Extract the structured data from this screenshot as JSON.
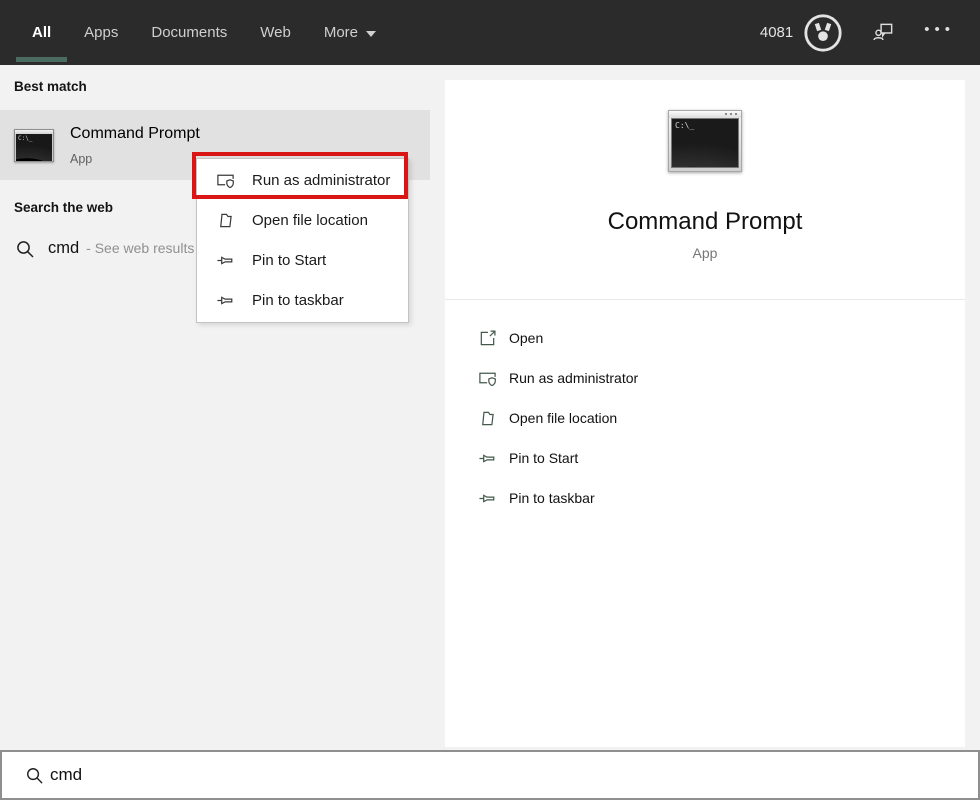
{
  "topbar": {
    "tabs": [
      {
        "label": "All",
        "active": true
      },
      {
        "label": "Apps",
        "active": false
      },
      {
        "label": "Documents",
        "active": false
      },
      {
        "label": "Web",
        "active": false
      },
      {
        "label": "More",
        "active": false,
        "has_dropdown": true
      }
    ],
    "rewards_count": "4081",
    "ellipsis": "•••"
  },
  "left_panel": {
    "best_match_header": "Best match",
    "best_match": {
      "title": "Command Prompt",
      "subtitle": "App"
    },
    "search_web_header": "Search the web",
    "web_item": {
      "query": "cmd",
      "suffix": "- See web results"
    }
  },
  "context_menu": {
    "items": [
      {
        "label": "Run as administrator",
        "icon": "run-as-admin-icon",
        "annotated": true
      },
      {
        "label": "Open file location",
        "icon": "folder-icon",
        "annotated": false
      },
      {
        "label": "Pin to Start",
        "icon": "pin-icon",
        "annotated": false
      },
      {
        "label": "Pin to taskbar",
        "icon": "pin-icon",
        "annotated": false
      }
    ]
  },
  "right_panel": {
    "title": "Command Prompt",
    "subtitle": "App",
    "app_icon_text": "C:\\_",
    "actions": [
      {
        "label": "Open",
        "icon": "open-icon"
      },
      {
        "label": "Run as administrator",
        "icon": "run-as-admin-icon"
      },
      {
        "label": "Open file location",
        "icon": "folder-icon"
      },
      {
        "label": "Pin to Start",
        "icon": "pin-icon"
      },
      {
        "label": "Pin to taskbar",
        "icon": "pin-icon"
      }
    ]
  },
  "search_bar": {
    "value": "cmd"
  },
  "colors": {
    "topbar_bg": "#2b2b2b",
    "accent_underline": "#4a6b60",
    "selection_bg": "#e1e1e1",
    "panel_bg": "#f2f2f2",
    "annotation_red": "#d91515",
    "action_icon_green": "#44584c",
    "search_border": "#8f8f8f"
  }
}
